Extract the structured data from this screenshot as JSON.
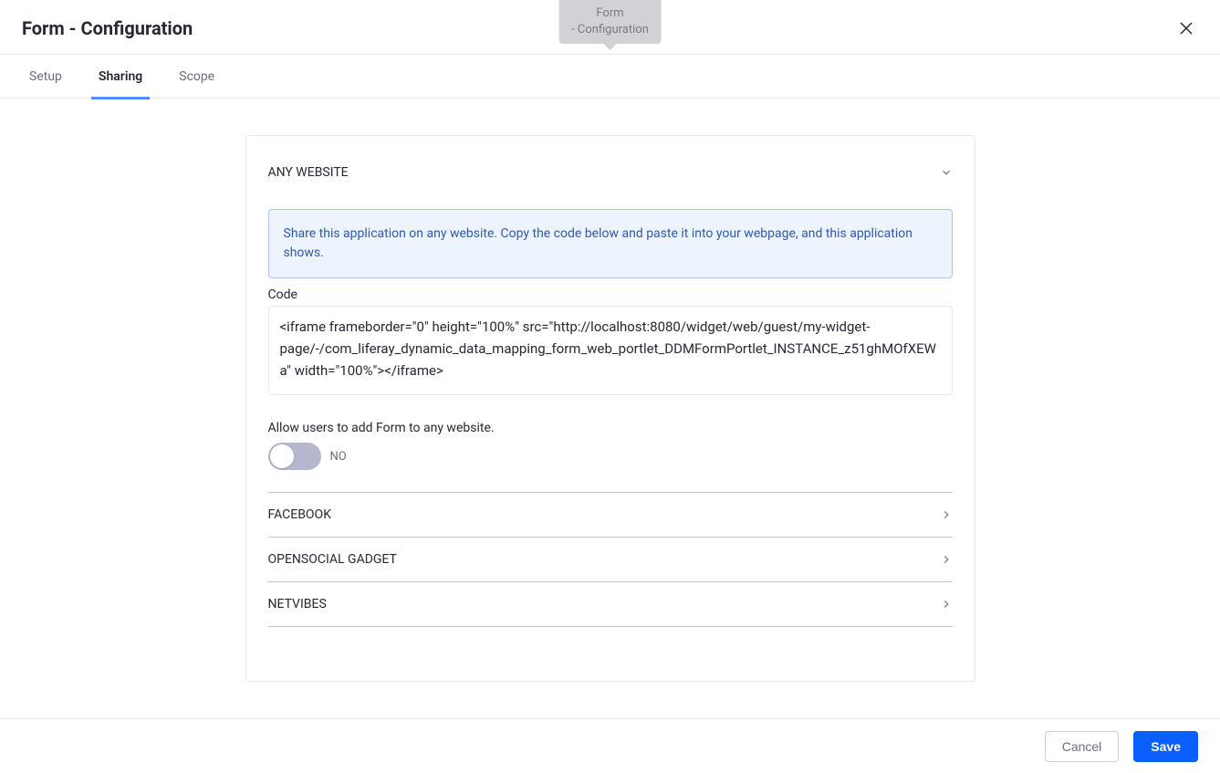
{
  "header": {
    "title": "Form - Configuration"
  },
  "tooltip": {
    "line1": "Form",
    "line2": "- Configuration"
  },
  "tabs": [
    {
      "label": "Setup",
      "active": false
    },
    {
      "label": "Sharing",
      "active": true
    },
    {
      "label": "Scope",
      "active": false
    }
  ],
  "sections": {
    "any_website": {
      "title": "ANY WEBSITE",
      "info": "Share this application on any website. Copy the code below and paste it into your webpage, and this application shows.",
      "code_label": "Code",
      "code_value": "<iframe frameborder=\"0\" height=\"100%\" src=\"http://localhost:8080/widget/web/guest/my-widget-page/-/com_liferay_dynamic_data_mapping_form_web_portlet_DDMFormPortlet_INSTANCE_z51ghMOfXEWa\" width=\"100%\"></iframe>",
      "toggle_label": "Allow users to add Form to any website.",
      "toggle_state": "NO"
    },
    "facebook": {
      "title": "FACEBOOK"
    },
    "opensocial": {
      "title": "OPENSOCIAL GADGET"
    },
    "netvibes": {
      "title": "NETVIBES"
    }
  },
  "footer": {
    "cancel": "Cancel",
    "save": "Save"
  }
}
